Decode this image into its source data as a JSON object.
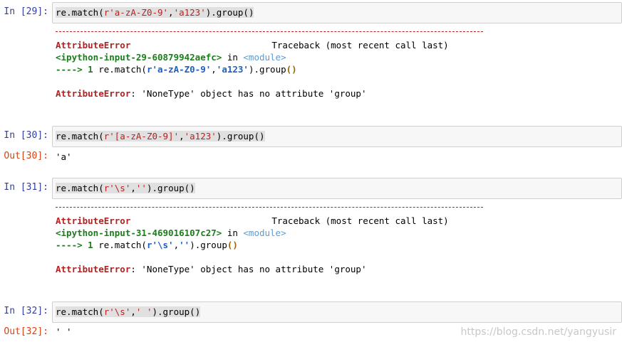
{
  "cells": [
    {
      "in_prompt": "In  [29]:",
      "code": {
        "pre": "re.match(",
        "pattern": "r'a-zA-Z0-9'",
        "comma": ",",
        "subject": "'a123'",
        "post": ").group()"
      },
      "traceback": {
        "error_name": "AttributeError",
        "header_tail": "Traceback (most recent call last)",
        "source": "<ipython-input-29-60879942aefc>",
        "in_word": " in ",
        "module": "<module>",
        "arrow": "----> 1 ",
        "line_pre": "re.match(",
        "line_pattern": "r'a-zA-Z0-9'",
        "line_comma": ",",
        "line_subject": "'a123'",
        "line_post": ").group",
        "line_paren": "()",
        "message_name": "AttributeError",
        "message": ": 'NoneType' object has no attribute 'group'"
      }
    },
    {
      "in_prompt": "In  [30]:",
      "code": {
        "pre": "re.match(",
        "pattern": "r'[a-zA-Z0-9]'",
        "comma": ",",
        "subject": "'a123'",
        "post": ").group()"
      },
      "out_prompt": "Out[30]:",
      "output": "'a'"
    },
    {
      "in_prompt": "In  [31]:",
      "code": {
        "pre": "re.match(",
        "pattern": "r'\\s'",
        "comma": ",",
        "subject": "''",
        "post": ").group()"
      },
      "traceback": {
        "error_name": "AttributeError",
        "header_tail": "Traceback (most recent call last)",
        "source": "<ipython-input-31-469016107c27>",
        "in_word": " in ",
        "module": "<module>",
        "arrow": "----> 1 ",
        "line_pre": "re.match(",
        "line_pattern": "r'\\s'",
        "line_comma": ",",
        "line_subject": "''",
        "line_post": ").group",
        "line_paren": "()",
        "message_name": "AttributeError",
        "message": ": 'NoneType' object has no attribute 'group'"
      }
    },
    {
      "in_prompt": "In  [32]:",
      "code": {
        "pre": "re.match(",
        "pattern": "r'\\s'",
        "comma": ",",
        "subject": "' '",
        "post": ").group()"
      },
      "out_prompt": "Out[32]:",
      "output": "' '"
    }
  ],
  "watermark": "https://blog.csdn.net/yangyusir"
}
